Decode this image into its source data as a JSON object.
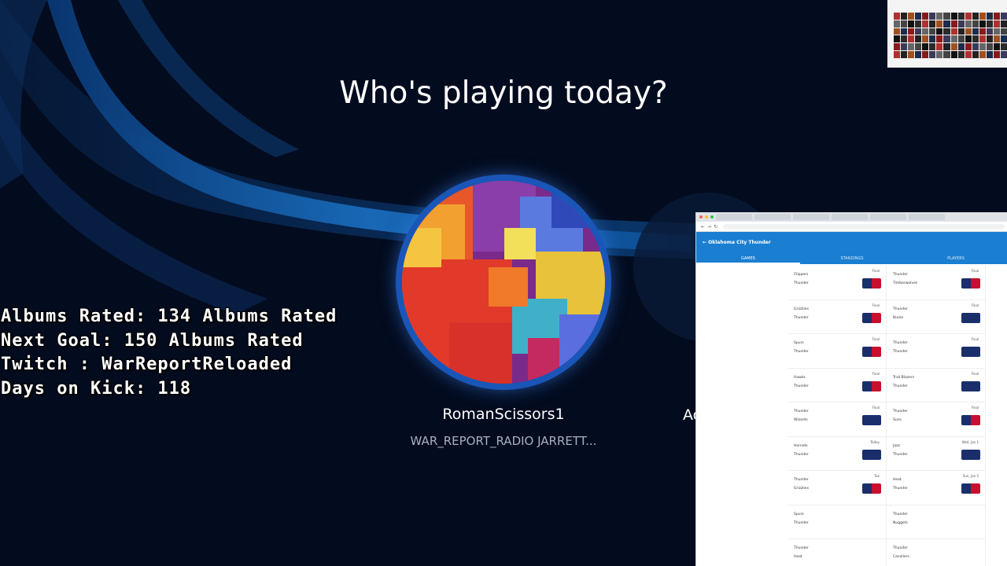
{
  "screen": {
    "title": "Who's playing today?",
    "profile": {
      "gamertag": "RomanScissors1",
      "subtitle": "WAR_REPORT_RADIO JARRETT..."
    },
    "next_profile_partial": "Ac"
  },
  "overlay_stats": [
    "Albums Rated: 134 Albums Rated",
    "Next Goal: 150 Albums Rated",
    "Twitch : WarReportReloaded",
    "Days on Kick: 118"
  ],
  "browser": {
    "header_title": "Oklahoma City Thunder",
    "tabs": [
      "GAMES",
      "STANDINGS",
      "PLAYERS"
    ],
    "games": [
      [
        {
          "a": "Clippers",
          "b": "Thunder",
          "st": "Final",
          "btn": "red"
        },
        {
          "a": "Thunder",
          "b": "Timberwolves",
          "st": "Final",
          "btn": "red"
        }
      ],
      [
        {
          "a": "Grizzlies",
          "b": "Thunder",
          "st": "Final",
          "btn": "red"
        },
        {
          "a": "Thunder",
          "b": "Bucks",
          "st": "Final",
          "btn": "navy"
        }
      ],
      [
        {
          "a": "Spurs",
          "b": "Thunder",
          "st": "Final",
          "btn": "red"
        },
        {
          "a": "Thunder",
          "b": "Thunder",
          "st": "Final",
          "btn": "navy"
        }
      ],
      [
        {
          "a": "Hawks",
          "b": "Thunder",
          "st": "Final",
          "btn": "red"
        },
        {
          "a": "Trail Blazers",
          "b": "Thunder",
          "st": "Final",
          "btn": "navy"
        }
      ],
      [
        {
          "a": "Thunder",
          "b": "Wizards",
          "st": "Final",
          "btn": "navy"
        },
        {
          "a": "Thunder",
          "b": "Suns",
          "st": "Final",
          "btn": "red"
        }
      ],
      [
        {
          "a": "Hornets",
          "b": "Thunder",
          "st": "Today",
          "btn": "navy"
        },
        {
          "a": "Jazz",
          "b": "Thunder",
          "st": "Wed, Jan 1",
          "btn": "navy"
        }
      ],
      [
        {
          "a": "Thunder",
          "b": "Grizzlies",
          "st": "Tue",
          "btn": "red"
        },
        {
          "a": "Heat",
          "b": "Thunder",
          "st": "Sun, Jan 5",
          "btn": "red"
        }
      ],
      [
        {
          "a": "Spurs",
          "b": "Thunder",
          "st": "",
          "btn": ""
        },
        {
          "a": "Thunder",
          "b": "Nuggets",
          "st": "",
          "btn": ""
        }
      ],
      [
        {
          "a": "Thunder",
          "b": "Heat",
          "st": "",
          "btn": ""
        },
        {
          "a": "Thunder",
          "b": "Cavaliers",
          "st": "",
          "btn": ""
        }
      ]
    ]
  },
  "colors": {
    "background": "#030b1e",
    "accent_blue": "#1a7fd1",
    "ring": "#1a56b8"
  }
}
